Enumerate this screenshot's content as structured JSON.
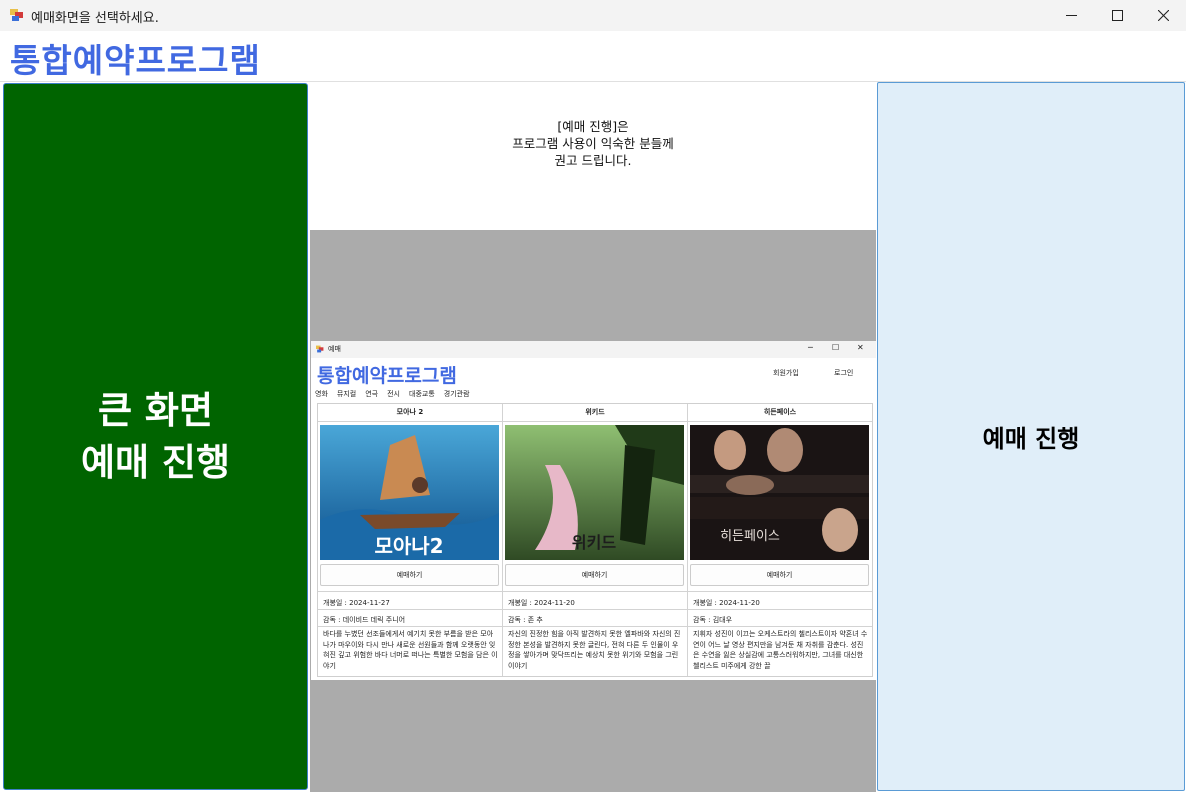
{
  "window": {
    "title": "예매화면을 선택하세요."
  },
  "header": {
    "title": "통합예약프로그램"
  },
  "left_panel": {
    "label": "큰 화면\n예매 진행"
  },
  "right_panel": {
    "label": "예매 진행"
  },
  "notice": {
    "text": "[예매 진행]은\n프로그램 사용이 익숙한 분들께\n권고 드립니다."
  },
  "preview": {
    "window_title": "예매",
    "title": "통합예약프로그램",
    "signup": "회원가입",
    "login": "로그인",
    "menu": [
      "영화",
      "뮤지컬",
      "연극",
      "전시",
      "대중교통",
      "경기관람"
    ],
    "movies": [
      {
        "title": "모아나 2",
        "poster_text": "모아나2",
        "button": "예매하기",
        "release": "개봉일 : 2024-11-27",
        "director": "감독 : 데이비드 데릭 주니어",
        "description": "바다를 누볐던 선조들에게서 예기치 못한 부름을 받은 모아나가 마우이와 다시 만나 새로운 선원들과 함께 오랫동안 잊혀진 깊고 위험한 바다 너머로 떠나는 특별한 모험을 담은 이야기"
      },
      {
        "title": "위키드",
        "poster_text": "위키드",
        "button": "예매하기",
        "release": "개봉일 : 2024-11-20",
        "director": "감독 : 존 추",
        "description": "자신의 진정한 힘을 아직 발견하지 못한 엘파바와 자신의 진정한 본성을 발견하지 못한 글린다, 전혀 다른 두 인물이 우정을 쌓아가며 맞닥뜨리는 예상치 못한 위기와 모험을 그린 이야기"
      },
      {
        "title": "히든페이스",
        "poster_text": "히든페이스",
        "button": "예매하기",
        "release": "개봉일 : 2024-11-20",
        "director": "감독 : 김대우",
        "description": "지휘자 성진이 이끄는 오케스트라의 첼리스트이자 약혼녀 수연이 어느 날 영상 편지만을 남겨둔 채 자취를 감춘다. 성진은 수연을 잃은 상실감에 고통스러워하지만, 그녀를 대신한 첼리스트 미주에게 강한 끌"
      }
    ]
  },
  "colors": {
    "accent": "#4169e1",
    "left_panel_bg": "#006400",
    "right_panel_bg": "#e0eef9"
  },
  "icons": {
    "app": "app-icon",
    "minimize": "minimize-icon",
    "maximize": "maximize-icon",
    "close": "close-icon"
  }
}
